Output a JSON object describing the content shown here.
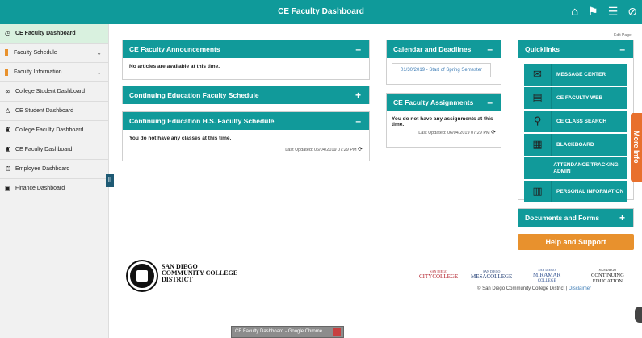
{
  "header": {
    "title": "CE Faculty Dashboard",
    "icons": [
      "home-icon",
      "flag-icon",
      "menu-icon",
      "compass-icon"
    ]
  },
  "sidebar": {
    "items": [
      {
        "label": "CE Faculty Dashboard",
        "icon": "dashboard-icon",
        "active": true
      },
      {
        "label": "Faculty Schedule",
        "icon": "bookmark-icon",
        "expandable": true
      },
      {
        "label": "Faculty Information",
        "icon": "bookmark-icon",
        "expandable": true
      },
      {
        "label": "College Student Dashboard",
        "icon": "infinity-icon"
      },
      {
        "label": "CE Student Dashboard",
        "icon": "student-icon"
      },
      {
        "label": "College Faculty Dashboard",
        "icon": "faculty-icon"
      },
      {
        "label": "CE Faculty Dashboard",
        "icon": "faculty-icon"
      },
      {
        "label": "Employee Dashboard",
        "icon": "employee-icon"
      },
      {
        "label": "Finance Dashboard",
        "icon": "finance-icon"
      }
    ],
    "toggle_label": "II"
  },
  "announcements": {
    "title": "CE Faculty Announcements",
    "ctrl": "–",
    "body": "No articles are available at this time."
  },
  "ce_schedule": {
    "title": "Continuing Education Faculty Schedule",
    "ctrl": "+"
  },
  "hs_schedule": {
    "title": "Continuing Education H.S. Faculty Schedule",
    "ctrl": "–",
    "body": "You do not have any classes at this time.",
    "updated": "Last Updated: 06/04/2019 07:29 PM"
  },
  "calendar": {
    "title": "Calendar and Deadlines",
    "ctrl": "–",
    "event": "01/30/2019 - Start of Spring Semester"
  },
  "assignments": {
    "title": "CE Faculty Assignments",
    "ctrl": "–",
    "body": "You do not have any assignments at this time.",
    "updated": "Last Updated: 06/04/2019 07:29 PM"
  },
  "quicklinks": {
    "edit_page": "Edit Page",
    "title": "Quicklinks",
    "ctrl": "–",
    "items": [
      {
        "label": "MESSAGE CENTER",
        "icon": "envelope-icon"
      },
      {
        "label": "CE FACULTY WEB",
        "icon": "web-icon"
      },
      {
        "label": "CE CLASS SEARCH",
        "icon": "magnifier-icon"
      },
      {
        "label": "BLACKBOARD",
        "icon": "blackboard-icon"
      },
      {
        "label": "ATTENDANCE TRACKING ADMIN",
        "icon": ""
      },
      {
        "label": "PERSONAL INFORMATION",
        "icon": "id-card-icon"
      }
    ]
  },
  "documents": {
    "title": "Documents and Forms",
    "ctrl": "+"
  },
  "help": {
    "label": "Help and Support"
  },
  "more_info": {
    "label": "More Info"
  },
  "footer": {
    "district_name": [
      "SAN DIEGO",
      "COMMUNITY COLLEGE",
      "DISTRICT"
    ],
    "colleges": [
      {
        "top": "SAN DIEGO",
        "bottom": "CITYCOLLEGE"
      },
      {
        "top": "SAN DIEGO",
        "bottom": "MESACOLLEGE"
      },
      {
        "top": "SAN DIEGO",
        "mid": "MIRAMAR",
        "bottom": "COLLEGE"
      },
      {
        "top": "SAN DIEGO",
        "mid": "CONTINUING",
        "bottom": "EDUCATION"
      }
    ],
    "copyright": "© San Diego Community College District |",
    "disclaimer": "Disclaimer"
  },
  "taskbar": {
    "label": "CE Faculty Dashboard - Google Chrome"
  }
}
